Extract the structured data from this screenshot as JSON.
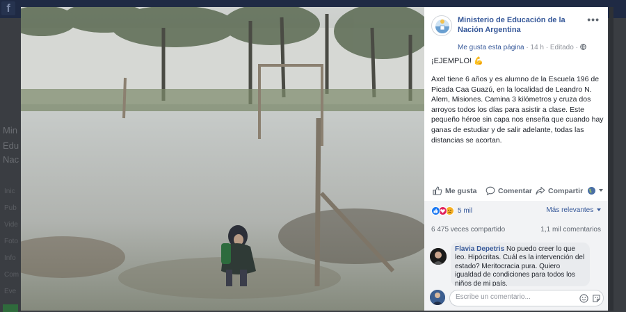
{
  "page": {
    "name": "Ministerio de Educación de la Nación Argentina",
    "follow_label": "Me gusta esta página",
    "time": "14 h",
    "edited": "Editado",
    "more": "•••"
  },
  "post": {
    "title": "¡EJEMPLO! 💪",
    "body": "Axel tiene 6 años y es alumno de la Escuela 196 de Picada Caa Guazú, en la localidad de Leandro N. Alem, Misiones. Camina 3 kilómetros y cruza dos arroyos todos los días para asistir a clase. Este pequeño héroe sin capa nos enseña que cuando hay ganas de estudiar y de salir adelante, todas las distancias se acortan."
  },
  "actions": {
    "like": "Me gusta",
    "comment": "Comentar",
    "share": "Compartir"
  },
  "stats": {
    "reactions": "5 mil",
    "sort": "Más relevantes",
    "shares": "6 475 veces compartido",
    "comments": "1,1 mil comentarios"
  },
  "comment": {
    "author": "Flavia Depetris",
    "text": "No puedo creer lo que leo. Hipócritas. Cuál es la intervención del estado? Meritocracia pura. Quiero igualdad de condiciones para todos los niños de mi país."
  },
  "composer": {
    "placeholder": "Escribe un comentario..."
  },
  "background": {
    "logo": "f",
    "left_items": [
      "Min",
      "Edu",
      "Nac",
      "Inic",
      "Pub",
      "Vide",
      "Foto",
      "Info",
      "Com",
      "Eve"
    ]
  },
  "colors": {
    "link": "#365899",
    "like": "#1877f2",
    "love": "#e0245e",
    "haha": "#f7b125"
  },
  "icons": {
    "like": "thumbs-up-icon",
    "comment": "comment-icon",
    "share": "share-icon",
    "audience": "globe-icon"
  }
}
